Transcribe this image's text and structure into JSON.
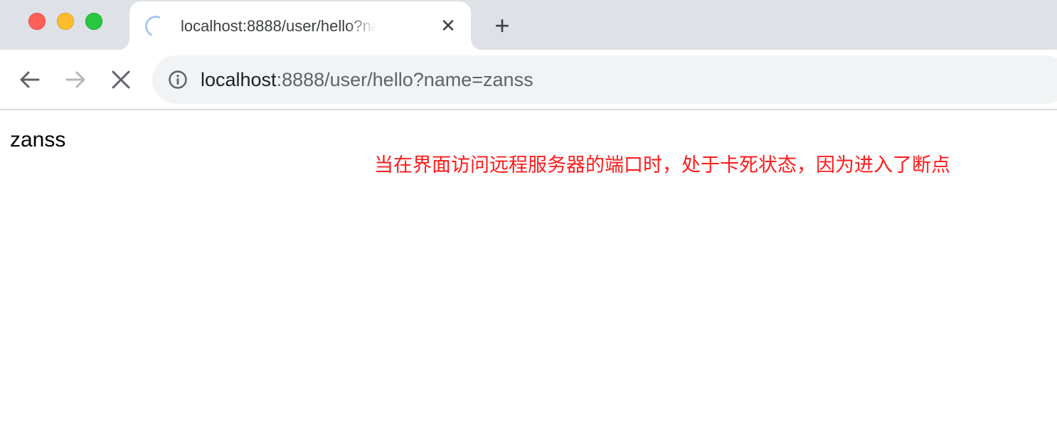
{
  "window": {
    "traffic_lights": [
      "close",
      "minimize",
      "maximize"
    ]
  },
  "tab": {
    "title": "localhost:8888/user/hello?name=zanss",
    "loading_icon": "spinner-icon",
    "close_icon": "close-icon"
  },
  "new_tab_icon": "plus-icon",
  "toolbar": {
    "back_icon": "arrow-left-icon",
    "forward_icon": "arrow-right-icon",
    "stop_icon": "stop-x-icon"
  },
  "address_bar": {
    "info_icon": "info-icon",
    "host": "localhost",
    "rest": ":8888/user/hello?name=zanss"
  },
  "page": {
    "body_text": "zanss"
  },
  "annotation": {
    "text": "当在界面访问远程服务器的端口时，处于卡死状态，因为进入了断点",
    "color": "#ff1a1a"
  }
}
